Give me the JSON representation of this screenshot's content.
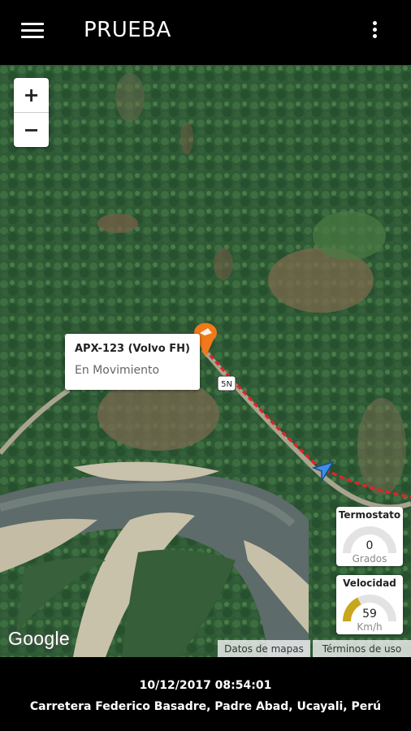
{
  "appbar": {
    "title": "PRUEBA",
    "menu_icon": "hamburger-menu-icon",
    "overflow_icon": "more-vert-icon"
  },
  "map": {
    "zoom_in_label": "+",
    "zoom_out_label": "−",
    "road_shield": "5N",
    "google_logo": "Google",
    "attribution_data": "Datos de mapas",
    "attribution_terms": "Términos de uso",
    "route_color": "#e0242a",
    "marker_color": "#f07a1a",
    "vehicle_icon_color": "#3d8ee8"
  },
  "popup": {
    "vehicle": "APX-123 (Volvo FH)",
    "status": "En Movimiento"
  },
  "gauges": {
    "thermostat": {
      "title": "Termostato",
      "value": "0",
      "unit": "Grados",
      "level": 0
    },
    "speed": {
      "title": "Velocidad",
      "value": "59",
      "unit": "Km/h",
      "level": 0.35,
      "color": "#c9a61c"
    }
  },
  "footer": {
    "datetime": "10/12/2017 08:54:01",
    "address": "Carretera Federico Basadre, Padre Abad, Ucayali, Perú"
  }
}
